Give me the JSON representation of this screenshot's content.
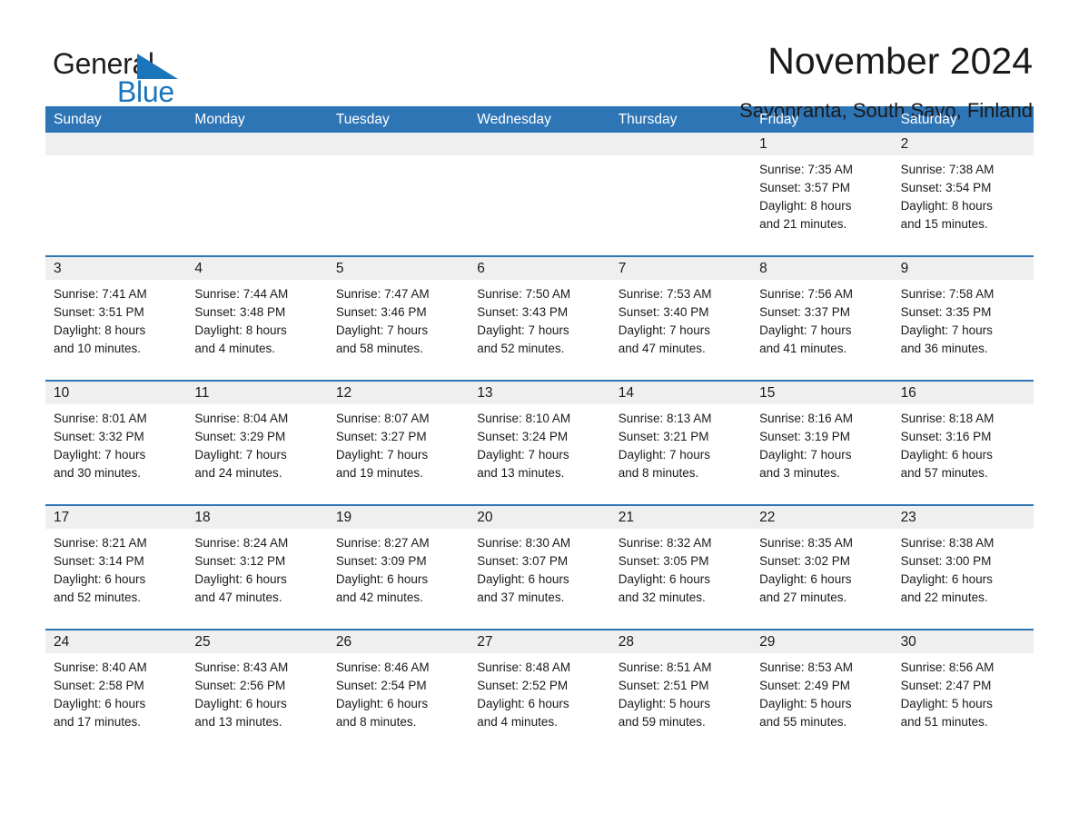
{
  "brand": {
    "name_part1": "General",
    "name_part2": "Blue",
    "triangle_color": "#1b75bb"
  },
  "header": {
    "title": "November 2024",
    "location": "Savonranta, South Savo, Finland"
  },
  "theme": {
    "header_blue": "#2e75b6",
    "daynum_band": "#efefef",
    "text": "#1a1a1a"
  },
  "weekdays": [
    "Sunday",
    "Monday",
    "Tuesday",
    "Wednesday",
    "Thursday",
    "Friday",
    "Saturday"
  ],
  "weeks": [
    {
      "days": [
        {
          "num": "",
          "lines": []
        },
        {
          "num": "",
          "lines": []
        },
        {
          "num": "",
          "lines": []
        },
        {
          "num": "",
          "lines": []
        },
        {
          "num": "",
          "lines": []
        },
        {
          "num": "1",
          "lines": [
            "Sunrise: 7:35 AM",
            "Sunset: 3:57 PM",
            "Daylight: 8 hours",
            "and 21 minutes."
          ]
        },
        {
          "num": "2",
          "lines": [
            "Sunrise: 7:38 AM",
            "Sunset: 3:54 PM",
            "Daylight: 8 hours",
            "and 15 minutes."
          ]
        }
      ]
    },
    {
      "days": [
        {
          "num": "3",
          "lines": [
            "Sunrise: 7:41 AM",
            "Sunset: 3:51 PM",
            "Daylight: 8 hours",
            "and 10 minutes."
          ]
        },
        {
          "num": "4",
          "lines": [
            "Sunrise: 7:44 AM",
            "Sunset: 3:48 PM",
            "Daylight: 8 hours",
            "and 4 minutes."
          ]
        },
        {
          "num": "5",
          "lines": [
            "Sunrise: 7:47 AM",
            "Sunset: 3:46 PM",
            "Daylight: 7 hours",
            "and 58 minutes."
          ]
        },
        {
          "num": "6",
          "lines": [
            "Sunrise: 7:50 AM",
            "Sunset: 3:43 PM",
            "Daylight: 7 hours",
            "and 52 minutes."
          ]
        },
        {
          "num": "7",
          "lines": [
            "Sunrise: 7:53 AM",
            "Sunset: 3:40 PM",
            "Daylight: 7 hours",
            "and 47 minutes."
          ]
        },
        {
          "num": "8",
          "lines": [
            "Sunrise: 7:56 AM",
            "Sunset: 3:37 PM",
            "Daylight: 7 hours",
            "and 41 minutes."
          ]
        },
        {
          "num": "9",
          "lines": [
            "Sunrise: 7:58 AM",
            "Sunset: 3:35 PM",
            "Daylight: 7 hours",
            "and 36 minutes."
          ]
        }
      ]
    },
    {
      "days": [
        {
          "num": "10",
          "lines": [
            "Sunrise: 8:01 AM",
            "Sunset: 3:32 PM",
            "Daylight: 7 hours",
            "and 30 minutes."
          ]
        },
        {
          "num": "11",
          "lines": [
            "Sunrise: 8:04 AM",
            "Sunset: 3:29 PM",
            "Daylight: 7 hours",
            "and 24 minutes."
          ]
        },
        {
          "num": "12",
          "lines": [
            "Sunrise: 8:07 AM",
            "Sunset: 3:27 PM",
            "Daylight: 7 hours",
            "and 19 minutes."
          ]
        },
        {
          "num": "13",
          "lines": [
            "Sunrise: 8:10 AM",
            "Sunset: 3:24 PM",
            "Daylight: 7 hours",
            "and 13 minutes."
          ]
        },
        {
          "num": "14",
          "lines": [
            "Sunrise: 8:13 AM",
            "Sunset: 3:21 PM",
            "Daylight: 7 hours",
            "and 8 minutes."
          ]
        },
        {
          "num": "15",
          "lines": [
            "Sunrise: 8:16 AM",
            "Sunset: 3:19 PM",
            "Daylight: 7 hours",
            "and 3 minutes."
          ]
        },
        {
          "num": "16",
          "lines": [
            "Sunrise: 8:18 AM",
            "Sunset: 3:16 PM",
            "Daylight: 6 hours",
            "and 57 minutes."
          ]
        }
      ]
    },
    {
      "days": [
        {
          "num": "17",
          "lines": [
            "Sunrise: 8:21 AM",
            "Sunset: 3:14 PM",
            "Daylight: 6 hours",
            "and 52 minutes."
          ]
        },
        {
          "num": "18",
          "lines": [
            "Sunrise: 8:24 AM",
            "Sunset: 3:12 PM",
            "Daylight: 6 hours",
            "and 47 minutes."
          ]
        },
        {
          "num": "19",
          "lines": [
            "Sunrise: 8:27 AM",
            "Sunset: 3:09 PM",
            "Daylight: 6 hours",
            "and 42 minutes."
          ]
        },
        {
          "num": "20",
          "lines": [
            "Sunrise: 8:30 AM",
            "Sunset: 3:07 PM",
            "Daylight: 6 hours",
            "and 37 minutes."
          ]
        },
        {
          "num": "21",
          "lines": [
            "Sunrise: 8:32 AM",
            "Sunset: 3:05 PM",
            "Daylight: 6 hours",
            "and 32 minutes."
          ]
        },
        {
          "num": "22",
          "lines": [
            "Sunrise: 8:35 AM",
            "Sunset: 3:02 PM",
            "Daylight: 6 hours",
            "and 27 minutes."
          ]
        },
        {
          "num": "23",
          "lines": [
            "Sunrise: 8:38 AM",
            "Sunset: 3:00 PM",
            "Daylight: 6 hours",
            "and 22 minutes."
          ]
        }
      ]
    },
    {
      "days": [
        {
          "num": "24",
          "lines": [
            "Sunrise: 8:40 AM",
            "Sunset: 2:58 PM",
            "Daylight: 6 hours",
            "and 17 minutes."
          ]
        },
        {
          "num": "25",
          "lines": [
            "Sunrise: 8:43 AM",
            "Sunset: 2:56 PM",
            "Daylight: 6 hours",
            "and 13 minutes."
          ]
        },
        {
          "num": "26",
          "lines": [
            "Sunrise: 8:46 AM",
            "Sunset: 2:54 PM",
            "Daylight: 6 hours",
            "and 8 minutes."
          ]
        },
        {
          "num": "27",
          "lines": [
            "Sunrise: 8:48 AM",
            "Sunset: 2:52 PM",
            "Daylight: 6 hours",
            "and 4 minutes."
          ]
        },
        {
          "num": "28",
          "lines": [
            "Sunrise: 8:51 AM",
            "Sunset: 2:51 PM",
            "Daylight: 5 hours",
            "and 59 minutes."
          ]
        },
        {
          "num": "29",
          "lines": [
            "Sunrise: 8:53 AM",
            "Sunset: 2:49 PM",
            "Daylight: 5 hours",
            "and 55 minutes."
          ]
        },
        {
          "num": "30",
          "lines": [
            "Sunrise: 8:56 AM",
            "Sunset: 2:47 PM",
            "Daylight: 5 hours",
            "and 51 minutes."
          ]
        }
      ]
    }
  ]
}
